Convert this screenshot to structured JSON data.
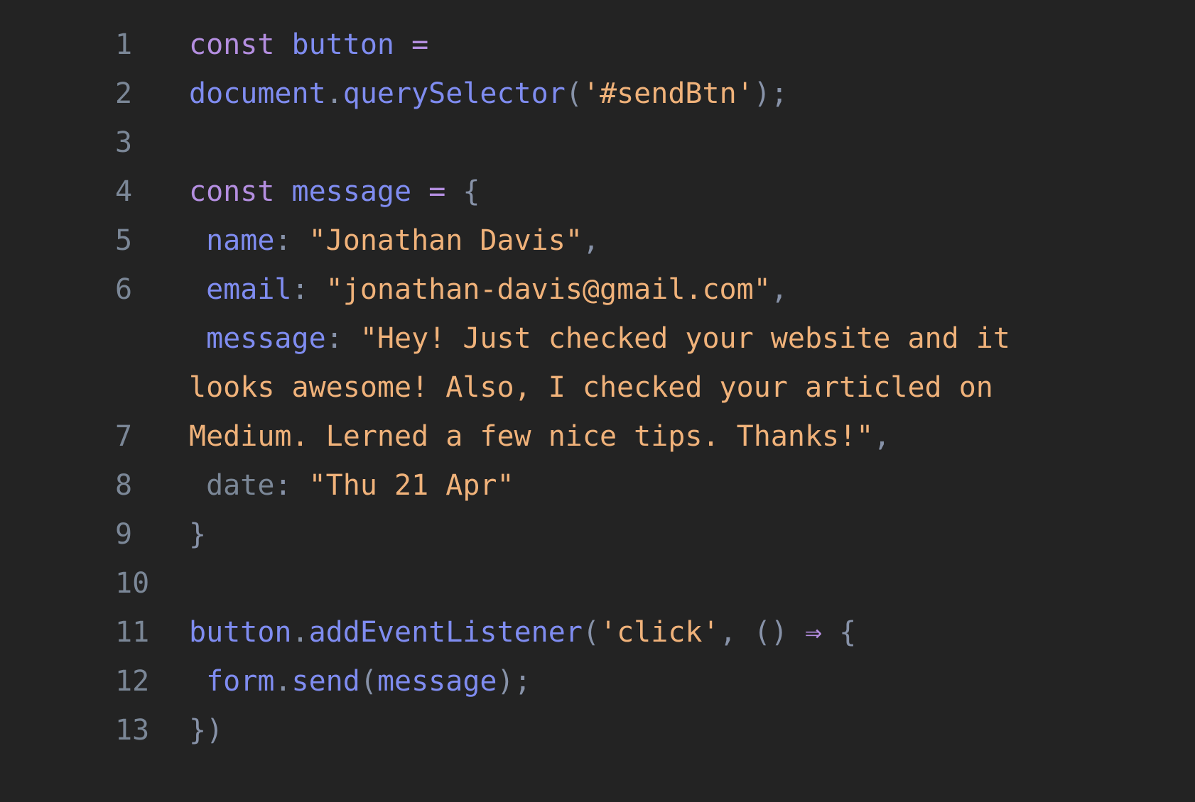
{
  "editor": {
    "lines": [
      {
        "num": "1",
        "tokens": [
          {
            "t": "const",
            "c": "kw"
          },
          {
            "t": " ",
            "c": "punc"
          },
          {
            "t": "button",
            "c": "id"
          },
          {
            "t": " ",
            "c": "punc"
          },
          {
            "t": "=",
            "c": "kw"
          }
        ]
      },
      {
        "num": "2",
        "tokens": [
          {
            "t": "document",
            "c": "id"
          },
          {
            "t": ".",
            "c": "punc"
          },
          {
            "t": "querySelector",
            "c": "id"
          },
          {
            "t": "(",
            "c": "punc"
          },
          {
            "t": "'#sendBtn'",
            "c": "str"
          },
          {
            "t": ");",
            "c": "punc"
          }
        ]
      },
      {
        "num": "3",
        "tokens": []
      },
      {
        "num": "4",
        "tokens": [
          {
            "t": "const",
            "c": "kw"
          },
          {
            "t": " ",
            "c": "punc"
          },
          {
            "t": "message",
            "c": "id"
          },
          {
            "t": " ",
            "c": "punc"
          },
          {
            "t": "=",
            "c": "kw"
          },
          {
            "t": " {",
            "c": "punc"
          }
        ]
      },
      {
        "num": "5",
        "tokens": [
          {
            "t": " name",
            "c": "prop"
          },
          {
            "t": ": ",
            "c": "punc"
          },
          {
            "t": "\"Jonathan Davis\"",
            "c": "str"
          },
          {
            "t": ",",
            "c": "punc"
          }
        ]
      },
      {
        "num": "6",
        "tokens": [
          {
            "t": " email",
            "c": "prop"
          },
          {
            "t": ": ",
            "c": "punc"
          },
          {
            "t": "\"jonathan-davis@gmail.com\"",
            "c": "str"
          },
          {
            "t": ",",
            "c": "punc"
          }
        ]
      },
      {
        "num": "",
        "tokens": [
          {
            "t": " message",
            "c": "prop"
          },
          {
            "t": ": ",
            "c": "punc"
          },
          {
            "t": "\"Hey! Just checked your website and it",
            "c": "str"
          }
        ]
      },
      {
        "num": "",
        "tokens": [
          {
            "t": "looks awesome! Also, I checked your articled on",
            "c": "str"
          }
        ]
      },
      {
        "num": "7",
        "tokens": [
          {
            "t": "Medium. Lerned a few nice tips. Thanks!\"",
            "c": "str"
          },
          {
            "t": ",",
            "c": "punc"
          }
        ]
      },
      {
        "num": "8",
        "tokens": [
          {
            "t": " date",
            "c": "dim"
          },
          {
            "t": ": ",
            "c": "punc"
          },
          {
            "t": "\"Thu 21 Apr\"",
            "c": "str"
          }
        ]
      },
      {
        "num": "9",
        "tokens": [
          {
            "t": "}",
            "c": "punc"
          }
        ]
      },
      {
        "num": "10",
        "tokens": []
      },
      {
        "num": "11",
        "tokens": [
          {
            "t": "button",
            "c": "id"
          },
          {
            "t": ".",
            "c": "punc"
          },
          {
            "t": "addEventListener",
            "c": "id"
          },
          {
            "t": "(",
            "c": "punc"
          },
          {
            "t": "'click'",
            "c": "str"
          },
          {
            "t": ", () ",
            "c": "punc"
          },
          {
            "t": "⇒",
            "c": "kw"
          },
          {
            "t": " {",
            "c": "punc"
          }
        ]
      },
      {
        "num": "12",
        "tokens": [
          {
            "t": " form",
            "c": "id"
          },
          {
            "t": ".",
            "c": "punc"
          },
          {
            "t": "send",
            "c": "id"
          },
          {
            "t": "(",
            "c": "punc"
          },
          {
            "t": "message",
            "c": "id"
          },
          {
            "t": ");",
            "c": "punc"
          }
        ]
      },
      {
        "num": "13",
        "tokens": [
          {
            "t": "})",
            "c": "punc"
          }
        ]
      }
    ]
  }
}
